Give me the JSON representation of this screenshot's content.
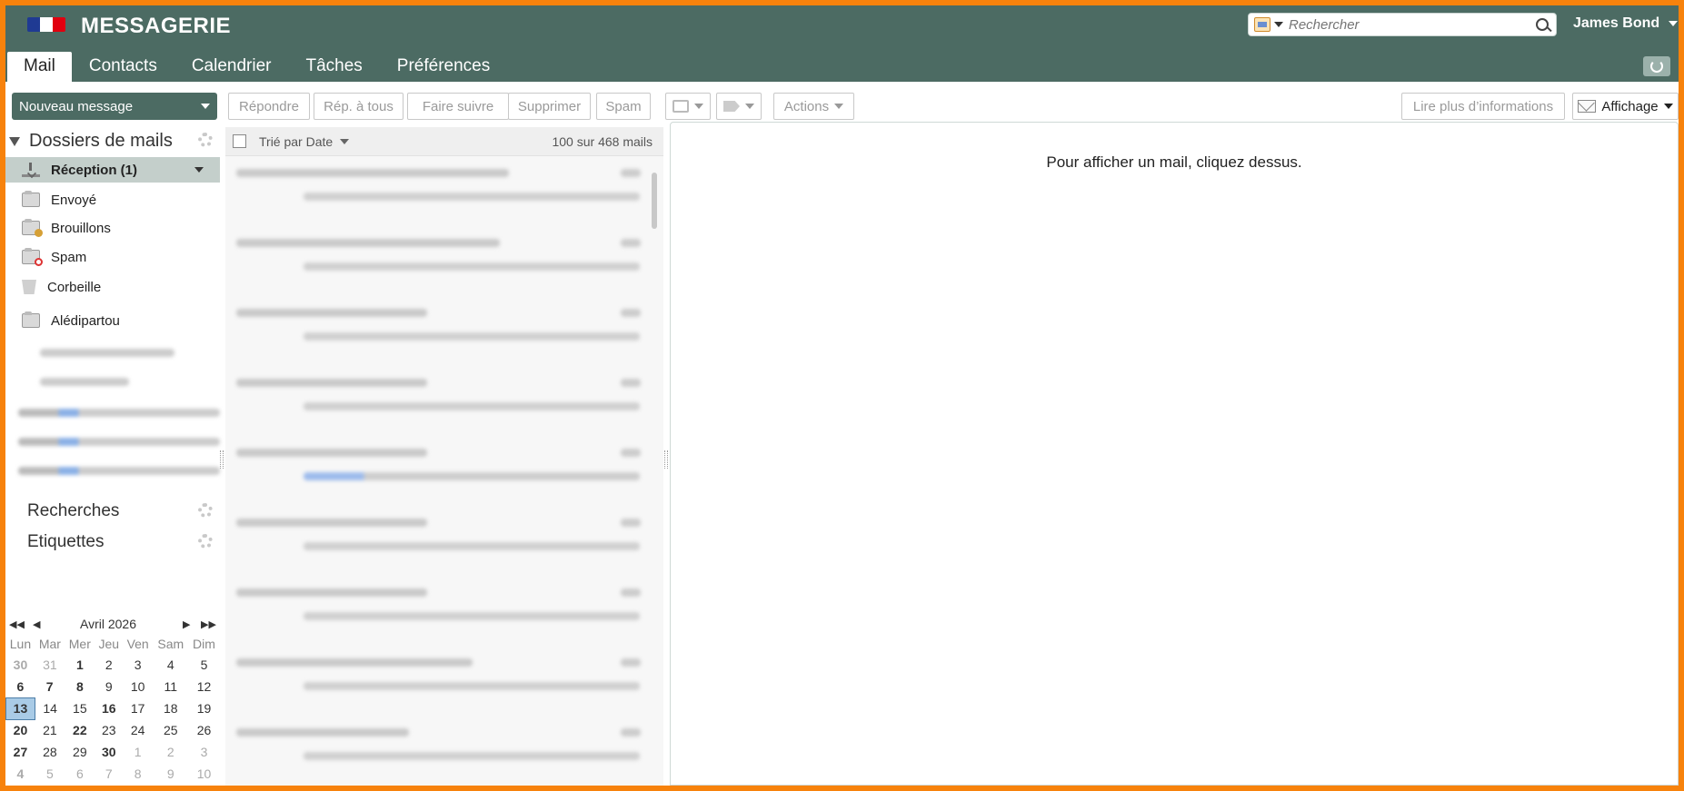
{
  "header": {
    "app_title": "MESSAGERIE",
    "search_placeholder": "Rechercher",
    "user_name": "James Bond",
    "flag_colors": [
      "#1f3a93",
      "#ffffff",
      "#e1000f"
    ]
  },
  "tabs": [
    {
      "label": "Mail",
      "active": true
    },
    {
      "label": "Contacts"
    },
    {
      "label": "Calendrier"
    },
    {
      "label": "Tâches"
    },
    {
      "label": "Préférences"
    }
  ],
  "toolbar": {
    "new_message": "Nouveau message",
    "reply": "Répondre",
    "reply_all": "Rép. à tous",
    "forward": "Faire suivre",
    "delete": "Supprimer",
    "spam": "Spam",
    "actions": "Actions",
    "more_info": "Lire plus d’informations",
    "display": "Affichage"
  },
  "folders": {
    "title": "Dossiers de mails",
    "items": [
      {
        "label": "Réception (1)",
        "icon": "inbox-icon",
        "active": true
      },
      {
        "label": "Envoyé",
        "icon": "sent-folder-icon"
      },
      {
        "label": "Brouillons",
        "icon": "drafts-folder-icon"
      },
      {
        "label": "Spam",
        "icon": "spam-folder-icon"
      },
      {
        "label": "Corbeille",
        "icon": "trash-icon"
      },
      {
        "label": "Alédipartou",
        "icon": "folder-icon"
      }
    ]
  },
  "sections": {
    "searches": "Recherches",
    "labels": "Etiquettes"
  },
  "calendar": {
    "month_label": "Avril 2026",
    "weekdays": [
      "Lun",
      "Mar",
      "Mer",
      "Jeu",
      "Ven",
      "Sam",
      "Dim"
    ],
    "weeks": [
      [
        {
          "d": "30",
          "s": "bold-muted"
        },
        {
          "d": "31",
          "s": "muted"
        },
        {
          "d": "1",
          "s": "bold"
        },
        {
          "d": "2"
        },
        {
          "d": "3"
        },
        {
          "d": "4"
        },
        {
          "d": "5"
        }
      ],
      [
        {
          "d": "6",
          "s": "bold"
        },
        {
          "d": "7",
          "s": "bold"
        },
        {
          "d": "8",
          "s": "bold"
        },
        {
          "d": "9"
        },
        {
          "d": "10"
        },
        {
          "d": "11"
        },
        {
          "d": "12"
        }
      ],
      [
        {
          "d": "13",
          "s": "today"
        },
        {
          "d": "14"
        },
        {
          "d": "15"
        },
        {
          "d": "16",
          "s": "bold"
        },
        {
          "d": "17"
        },
        {
          "d": "18"
        },
        {
          "d": "19"
        }
      ],
      [
        {
          "d": "20",
          "s": "bold"
        },
        {
          "d": "21"
        },
        {
          "d": "22",
          "s": "bold"
        },
        {
          "d": "23"
        },
        {
          "d": "24"
        },
        {
          "d": "25"
        },
        {
          "d": "26"
        }
      ],
      [
        {
          "d": "27",
          "s": "bold"
        },
        {
          "d": "28"
        },
        {
          "d": "29"
        },
        {
          "d": "30",
          "s": "bold"
        },
        {
          "d": "1",
          "s": "muted"
        },
        {
          "d": "2",
          "s": "muted"
        },
        {
          "d": "3",
          "s": "muted"
        }
      ],
      [
        {
          "d": "4",
          "s": "bold-muted"
        },
        {
          "d": "5",
          "s": "muted"
        },
        {
          "d": "6",
          "s": "muted"
        },
        {
          "d": "7",
          "s": "muted"
        },
        {
          "d": "8",
          "s": "muted"
        },
        {
          "d": "9",
          "s": "muted"
        },
        {
          "d": "10",
          "s": "muted"
        }
      ]
    ]
  },
  "message_list": {
    "sort_label": "Trié par Date",
    "count_label": "100 sur 468 mails",
    "visible_rows": 9
  },
  "reader": {
    "hint": "Pour afficher un mail, cliquez dessus."
  }
}
